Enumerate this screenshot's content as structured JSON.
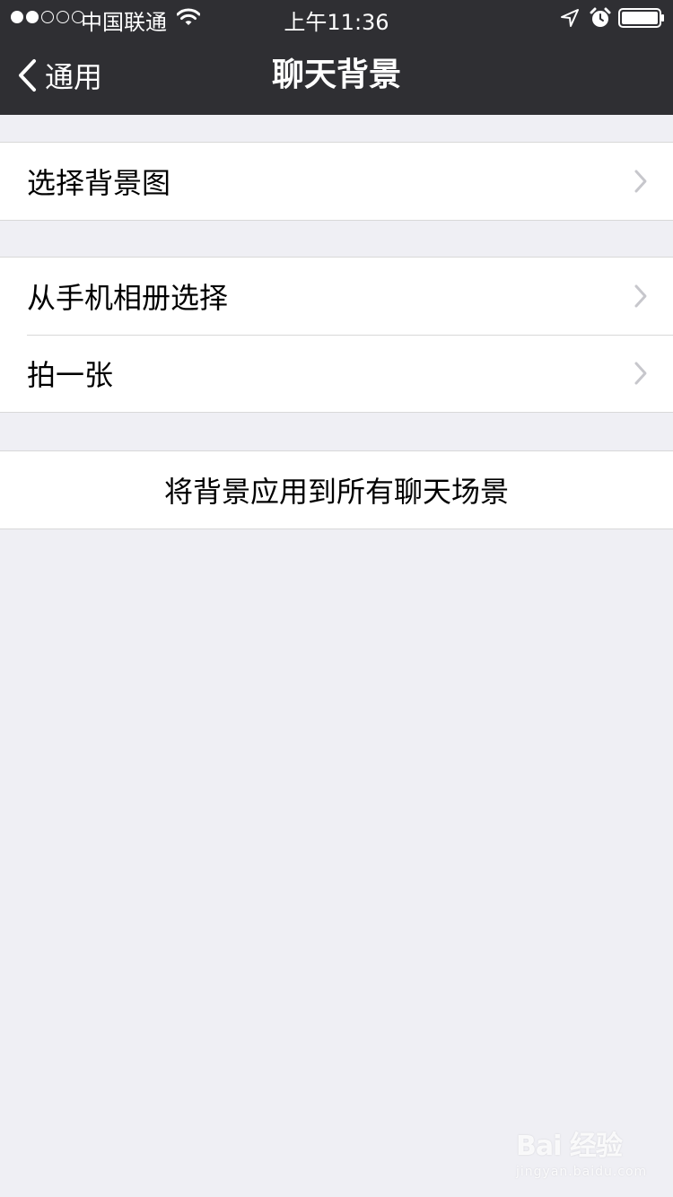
{
  "status_bar": {
    "carrier": "中国联通",
    "time": "上午11:36",
    "signal_bars_filled": 2,
    "signal_bars_total": 5
  },
  "nav": {
    "back_label": "通用",
    "title": "聊天背景"
  },
  "groups": [
    {
      "items": [
        {
          "label": "选择背景图"
        }
      ]
    },
    {
      "items": [
        {
          "label": "从手机相册选择"
        },
        {
          "label": "拍一张"
        }
      ]
    },
    {
      "items": [
        {
          "label": "将背景应用到所有聊天场景"
        }
      ]
    }
  ],
  "watermark": {
    "brand": "Bai 经验",
    "url": "jingyan.baidu.com"
  },
  "colors": {
    "nav_background": "#2f2f33",
    "page_background": "#efeff4",
    "chevron": "#c7c7cc"
  }
}
